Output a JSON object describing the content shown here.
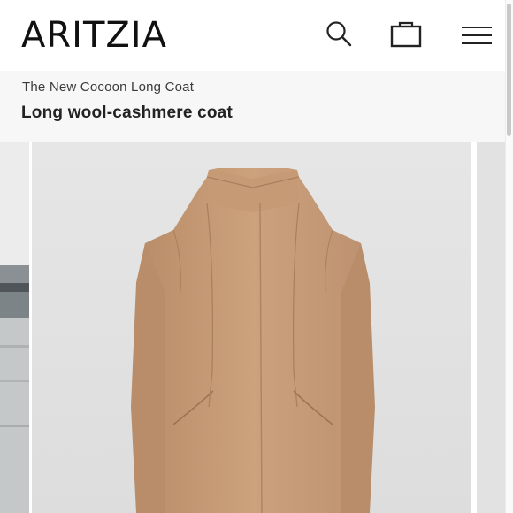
{
  "header": {
    "logo_text": "ARITZIA",
    "icons": {
      "search": "search-icon",
      "bag": "shopping-bag-icon",
      "menu": "hamburger-menu-icon"
    }
  },
  "breadcrumb": {
    "label": "The New Cocoon Long Coat"
  },
  "product": {
    "title": "Long wool-cashmere coat",
    "image_color": "#c99f7a"
  },
  "colors": {
    "background": "#ffffff",
    "subbar": "#f7f7f7",
    "coat": "#c99f7a",
    "photo_backdrop": "#e4e4e4"
  }
}
